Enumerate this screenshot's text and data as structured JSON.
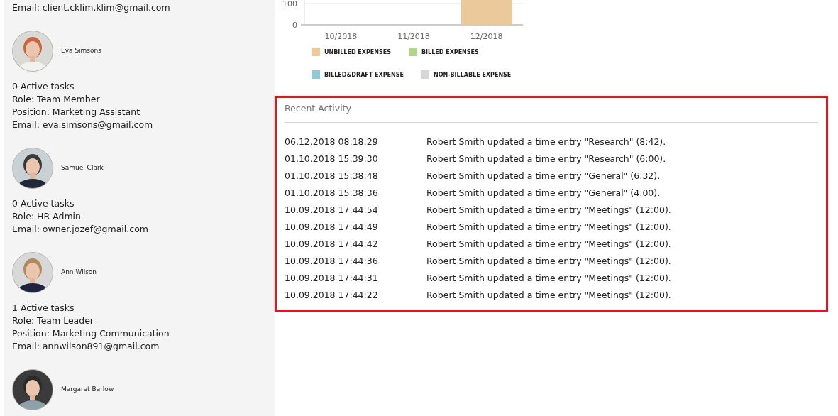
{
  "sidebar": {
    "top_line": "Email: client.cklim.klim@gmail.com",
    "people": [
      {
        "name": "Eva Simsons",
        "details": [
          "0 Active tasks",
          "Role: Team Member",
          "Position: Marketing Assistant",
          "Email: eva.simsons@gmail.com"
        ]
      },
      {
        "name": "Samuel Clark",
        "details": [
          "0 Active tasks",
          "Role: HR Admin",
          "Email: owner.jozef@gmail.com"
        ]
      },
      {
        "name": "Ann Wilson",
        "details": [
          "1 Active tasks",
          "Role: Team Leader",
          "Position: Marketing Communication",
          "Email: annwilson891@gmail.com"
        ]
      },
      {
        "name": "Margaret Barlow"
      }
    ]
  },
  "expenses": {
    "chart_data": {
      "type": "bar",
      "categories": [
        "10/2018",
        "11/2018",
        "12/2018"
      ],
      "yticks": [
        0,
        100
      ],
      "ylim": [
        0,
        117
      ],
      "series": [
        {
          "name": "UNBILLED EXPENSES",
          "color": "#ecc99a",
          "values": [
            0,
            0,
            117
          ]
        },
        {
          "name": "BILLED EXPENSES",
          "color": "#b2d58e",
          "values": [
            0,
            0,
            0
          ]
        },
        {
          "name": "BILLED&DRAFT EXPENSE",
          "color": "#8ecad6",
          "values": [
            0,
            0,
            0
          ]
        },
        {
          "name": "NON-BILLABLE EXPENSE",
          "color": "#d6d6d6",
          "values": [
            0,
            0,
            0
          ]
        }
      ]
    }
  },
  "recent_activity": {
    "title": "Recent Activity",
    "rows": [
      {
        "time": "06.12.2018 08:18:29",
        "message": "Robert Smith updated a time entry \"Research\" (8:42)."
      },
      {
        "time": "01.10.2018 15:39:30",
        "message": "Robert Smith updated a time entry \"Research\" (6:00)."
      },
      {
        "time": "01.10.2018 15:38:48",
        "message": "Robert Smith updated a time entry \"General\" (6:32)."
      },
      {
        "time": "01.10.2018 15:38:36",
        "message": "Robert Smith updated a time entry \"General\" (4:00)."
      },
      {
        "time": "10.09.2018 17:44:54",
        "message": "Robert Smith updated a time entry \"Meetings\" (12:00)."
      },
      {
        "time": "10.09.2018 17:44:49",
        "message": "Robert Smith updated a time entry \"Meetings\" (12:00)."
      },
      {
        "time": "10.09.2018 17:44:42",
        "message": "Robert Smith updated a time entry \"Meetings\" (12:00)."
      },
      {
        "time": "10.09.2018 17:44:36",
        "message": "Robert Smith updated a time entry \"Meetings\" (12:00)."
      },
      {
        "time": "10.09.2018 17:44:31",
        "message": "Robert Smith updated a time entry \"Meetings\" (12:00)."
      },
      {
        "time": "10.09.2018 17:44:22",
        "message": "Robert Smith updated a time entry \"Meetings\" (12:00)."
      }
    ]
  }
}
